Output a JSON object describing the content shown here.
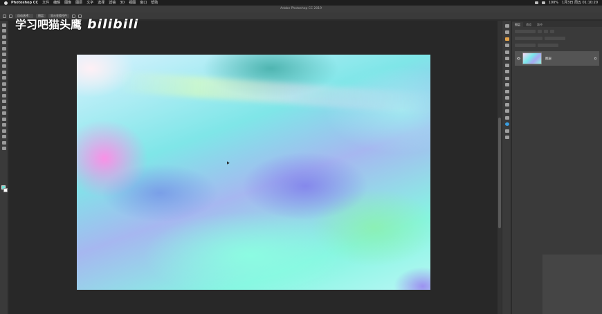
{
  "menubar": {
    "app_name": "Photoshop CC",
    "items": [
      "文件",
      "编辑",
      "图像",
      "图层",
      "文字",
      "选择",
      "滤镜",
      "3D",
      "视图",
      "窗口",
      "帮助"
    ],
    "clock": "1月3日 周五  01:10:20",
    "battery": "100%"
  },
  "titlebar": {
    "title": "Adobe Photoshop CC 2019"
  },
  "options": {
    "auto_select": "自动选择：",
    "layer_dropdown": "图层",
    "show_transform": "显示变换控件"
  },
  "watermark": {
    "text": "学习吧猫头鹰",
    "logo": "bilibili"
  },
  "panels": {
    "tabs": [
      "图层",
      "通道",
      "路径"
    ],
    "layer_name": "图层"
  }
}
